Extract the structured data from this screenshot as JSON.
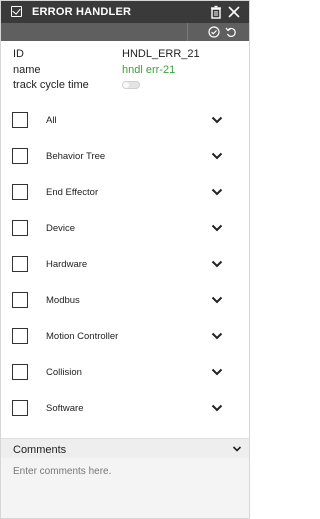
{
  "header": {
    "title": "ERROR HANDLER"
  },
  "props": {
    "id_label": "ID",
    "id_value": "HNDL_ERR_21",
    "name_label": "name",
    "name_value": "hndl err-21",
    "track_label": "track cycle time"
  },
  "categories": [
    {
      "label": "All"
    },
    {
      "label": "Behavior Tree"
    },
    {
      "label": "End Effector"
    },
    {
      "label": "Device"
    },
    {
      "label": "Hardware"
    },
    {
      "label": "Modbus"
    },
    {
      "label": "Motion Controller"
    },
    {
      "label": "Collision"
    },
    {
      "label": "Software"
    }
  ],
  "comments": {
    "label": "Comments",
    "placeholder": "Enter comments here."
  },
  "colors": {
    "titlebar": "#3a3a3a",
    "toolbar": "#5f5f5f",
    "name_value": "#3aa33a"
  },
  "icons": [
    "checkbox-icon",
    "trash-icon",
    "close-icon",
    "check-circle-icon",
    "undo-icon",
    "chevron-down-icon"
  ]
}
